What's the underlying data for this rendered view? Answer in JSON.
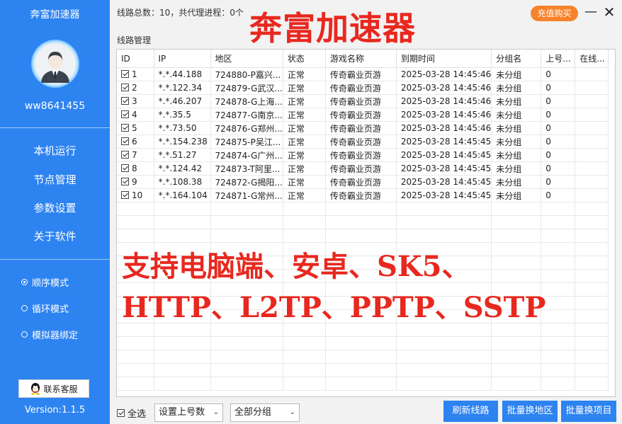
{
  "app": {
    "title": "奔富加速器",
    "username": "ww8641455",
    "version": "Version:1.1.5"
  },
  "nav": [
    {
      "label": "本机运行"
    },
    {
      "label": "节点管理"
    },
    {
      "label": "参数设置"
    },
    {
      "label": "关于软件"
    }
  ],
  "modes": [
    {
      "label": "顺序模式",
      "selected": true
    },
    {
      "label": "循环模式",
      "selected": false
    },
    {
      "label": "模拟器绑定",
      "selected": false
    }
  ],
  "support": {
    "label": "联系客服"
  },
  "header": {
    "stats": "线路总数：10，共代理进程：0个",
    "recharge": "充值购买",
    "group_label": "线路管理"
  },
  "colors": {
    "accent": "#2d83f0",
    "recharge": "#f7822b",
    "banner": "#e8281f"
  },
  "table": {
    "columns": [
      "ID",
      "IP",
      "地区",
      "状态",
      "游戏名称",
      "到期时间",
      "分组名",
      "上号...",
      "在线..."
    ],
    "rows": [
      {
        "checked": true,
        "cells": [
          "1",
          "*.*.44.188",
          "724880-P嘉兴...",
          "正常",
          "传奇霸业页游",
          "2025-03-28 14:45:46",
          "未分组",
          "0",
          ""
        ]
      },
      {
        "checked": true,
        "cells": [
          "2",
          "*.*.122.34",
          "724879-G武汉...",
          "正常",
          "传奇霸业页游",
          "2025-03-28 14:45:46",
          "未分组",
          "0",
          ""
        ]
      },
      {
        "checked": true,
        "cells": [
          "3",
          "*.*.46.207",
          "724878-G上海...",
          "正常",
          "传奇霸业页游",
          "2025-03-28 14:45:46",
          "未分组",
          "0",
          ""
        ]
      },
      {
        "checked": true,
        "cells": [
          "4",
          "*.*.35.5",
          "724877-G南京...",
          "正常",
          "传奇霸业页游",
          "2025-03-28 14:45:46",
          "未分组",
          "0",
          ""
        ]
      },
      {
        "checked": true,
        "cells": [
          "5",
          "*.*.73.50",
          "724876-G郑州...",
          "正常",
          "传奇霸业页游",
          "2025-03-28 14:45:46",
          "未分组",
          "0",
          ""
        ]
      },
      {
        "checked": true,
        "cells": [
          "6",
          "*.*.154.238",
          "724875-P吴江...",
          "正常",
          "传奇霸业页游",
          "2025-03-28 14:45:45",
          "未分组",
          "0",
          ""
        ]
      },
      {
        "checked": true,
        "cells": [
          "7",
          "*.*.51.27",
          "724874-G广州...",
          "正常",
          "传奇霸业页游",
          "2025-03-28 14:45:45",
          "未分组",
          "0",
          ""
        ]
      },
      {
        "checked": true,
        "cells": [
          "8",
          "*.*.124.42",
          "724873-T阿里...",
          "正常",
          "传奇霸业页游",
          "2025-03-28 14:45:45",
          "未分组",
          "0",
          ""
        ]
      },
      {
        "checked": true,
        "cells": [
          "9",
          "*.*.108.38",
          "724872-G揭阳...",
          "正常",
          "传奇霸业页游",
          "2025-03-28 14:45:45",
          "未分组",
          "0",
          ""
        ]
      },
      {
        "checked": true,
        "cells": [
          "10",
          "*.*.164.104",
          "724871-G常州...",
          "正常",
          "传奇霸业页游",
          "2025-03-28 14:45:45",
          "未分组",
          "0",
          ""
        ]
      }
    ]
  },
  "banner": {
    "title": "奔富加速器",
    "line1": "支持电脑端、安卓、SK5、",
    "line2": "HTTP、L2TP、PPTP、SSTP"
  },
  "footer": {
    "select_all": "全选",
    "select_all_checked": true,
    "account_dropdown": "设置上号数",
    "group_dropdown": "全部分组",
    "refresh": "刷新线路",
    "batch_region": "批量换地区",
    "batch_project": "批量换项目"
  }
}
